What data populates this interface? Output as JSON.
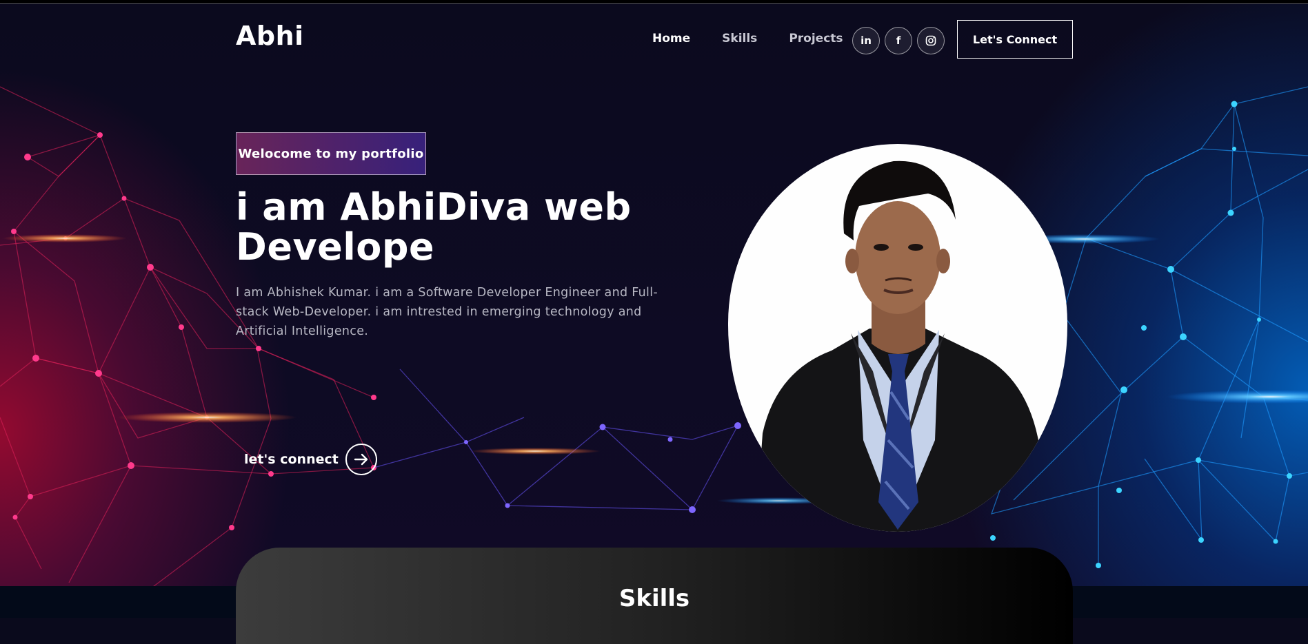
{
  "header": {
    "logo": "Abhi",
    "nav": [
      {
        "label": "Home",
        "active": true
      },
      {
        "label": "Skills",
        "active": false
      },
      {
        "label": "Projects",
        "active": false
      }
    ],
    "socials": [
      {
        "icon": "linkedin-icon",
        "glyph": "in"
      },
      {
        "icon": "facebook-icon",
        "glyph": "f"
      },
      {
        "icon": "instagram-icon",
        "glyph": ""
      }
    ],
    "connect_label": "Let's Connect"
  },
  "hero": {
    "tagline": "Welocome to my portfolio",
    "headline": "i am AbhiDiva web Develope",
    "bio": "I am Abhishek Kumar. i am a Software Developer Engineer and Full-stack Web-Developer. i am intrested in emerging technology and Artificial Intelligence.",
    "cta_label": "let's connect"
  },
  "skills": {
    "title": "Skills"
  },
  "colors": {
    "left_glow": "#c0103a",
    "right_glow": "#0a7de6",
    "tagline_gradient_start": "#aa367c",
    "tagline_gradient_end": "#4a2fbd"
  }
}
